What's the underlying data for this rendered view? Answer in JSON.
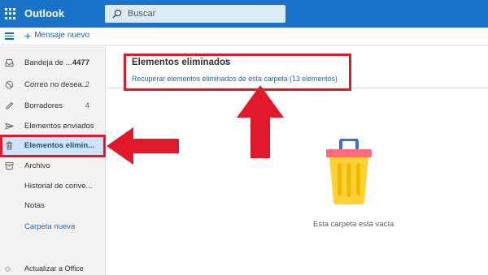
{
  "header": {
    "app_title": "Outlook",
    "search_placeholder": "Buscar"
  },
  "toolbar": {
    "new_message_label": "Mensaje nuevo"
  },
  "sidebar": {
    "items": [
      {
        "label": "Bandeja de ...",
        "count": "4477",
        "icon": "inbox-icon"
      },
      {
        "label": "Correo no desea...",
        "count": "2",
        "icon": "junk-icon"
      },
      {
        "label": "Borradores",
        "count": "4",
        "icon": "pencil-icon"
      },
      {
        "label": "Elementos enviados",
        "count": "",
        "icon": "send-icon"
      },
      {
        "label": "Elementos elimin...",
        "count": "",
        "icon": "trash-icon"
      },
      {
        "label": "Archivo",
        "count": "",
        "icon": "archive-icon"
      },
      {
        "label": "Historial de conve...",
        "count": "",
        "icon": ""
      },
      {
        "label": "Notas",
        "count": "",
        "icon": ""
      },
      {
        "label": "Carpeta nueva",
        "count": "",
        "icon": ""
      }
    ],
    "bottom_label": "Actualizar a Office"
  },
  "main": {
    "folder_title": "Elementos eliminados",
    "recover_link": "Recuperar elementos eliminados de esta carpeta (13 elementos)",
    "empty_text": "Esta carpeta está vacía"
  },
  "colors": {
    "brand": "#1a73c8",
    "accent": "#0f6cbd",
    "highlight": "#e11a2b",
    "selected": "#cfe4fa"
  }
}
